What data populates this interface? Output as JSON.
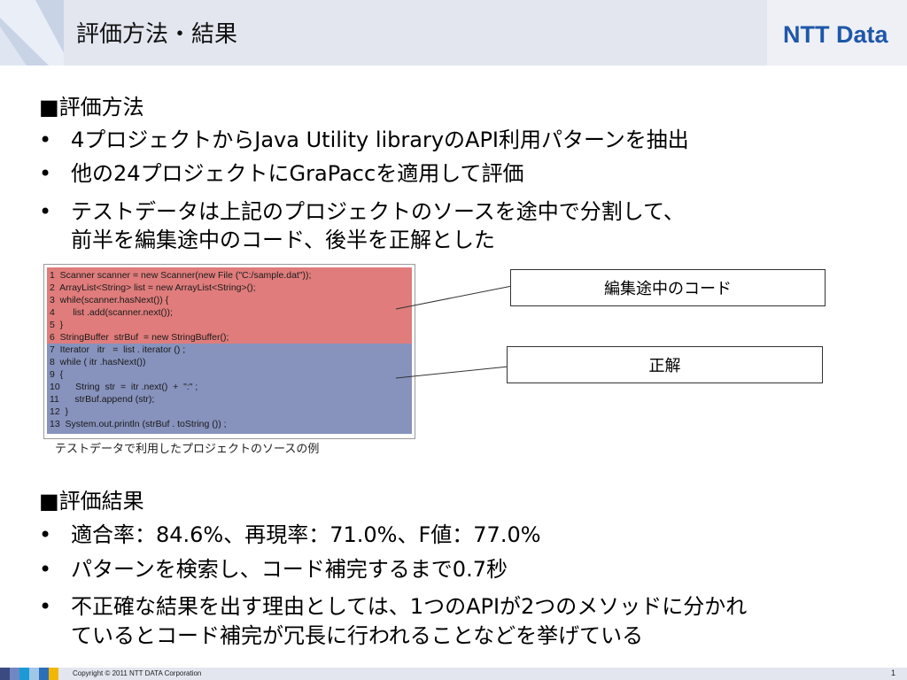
{
  "header": {
    "title": "評価方法・結果",
    "logo": "NTT Data"
  },
  "method": {
    "heading": "■評価方法",
    "bullets": [
      "4プロジェクトからJava Utility libraryのAPI利用パターンを抽出",
      "他の24プロジェクトにGraPaccを適用して評価",
      "テストデータは上記のプロジェクトのソースを途中で分割して、",
      "前半を編集途中のコード、後半を正解とした"
    ]
  },
  "code": {
    "lines": [
      "1  Scanner scanner = new Scanner(new File (\"C:/sample.dat\"));",
      "2  ArrayList<String> list = new ArrayList<String>();",
      "3  while(scanner.hasNext()) {",
      "4       list .add(scanner.next());",
      "5  }",
      "6  StringBuffer  strBuf  = new StringBuffer();",
      "7  Iterator   itr   =  list . iterator () ;",
      "8  while ( itr .hasNext())",
      "9  {",
      "10      String  str  =  itr .next()  +  \":\" ;",
      "11      strBuf.append (str);",
      "12  }",
      "13  System.out.println (strBuf . toString ()) ;"
    ],
    "caption": "テストデータで利用したプロジェクトのソースの例",
    "callout_partial": "編集途中のコード",
    "callout_answer": "正解"
  },
  "result": {
    "heading": "■評価結果",
    "bullets": [
      "適合率：84.6%、再現率：71.0%、F値：77.0%",
      "パターンを検索し、コード補完するまで0.7秒",
      "不正確な結果を出す理由としては、1つのAPIが2つのメソッドに分かれ",
      "ているとコード補完が冗長に行われることなどを挙げている"
    ]
  },
  "bullet_symbol": "•",
  "footer": {
    "copyright": "Copyright © 2011 NTT DATA Corporation",
    "page": "1"
  },
  "colors": {
    "header_bg": "#e3e6ef",
    "code_red": "#e07c7c",
    "code_blue": "#8792bd",
    "logo": "#1f57a8"
  }
}
